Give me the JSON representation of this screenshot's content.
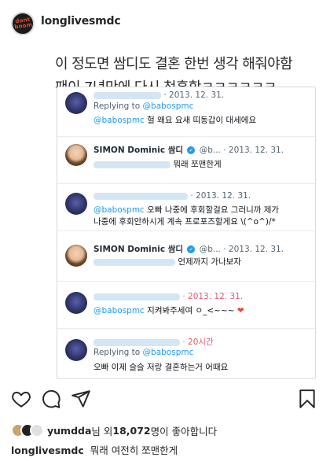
{
  "header": {
    "username": "longlivesmdc",
    "avatar_text": "dont\nboom"
  },
  "caption": {
    "line1": "이 정도면 쌈디도 결혼 한번 생각 해줘야함",
    "line2": "팬이 7년만에 다시 청혼함ㅋㅋㅋㅋㅋㅋ"
  },
  "tweets": [
    {
      "kind": "fan",
      "replying_label": "Replying to",
      "reply_to": "@babospmc",
      "date": "· 2013. 12. 31.",
      "mention": "@babospmc",
      "text": "헐 왜요 요새 띠동갑이 대세에요"
    },
    {
      "kind": "simon",
      "name": "SIMON Dominic 쌈디",
      "handle": "@b...",
      "date": "· 2013. 12. 31.",
      "text": "뭐래 쪼맨한게"
    },
    {
      "kind": "fan",
      "date": "· 2013. 12. 31.",
      "mention": "@babospmc",
      "text": "오빠 나중에 후회할걸요 그러니까 제가",
      "text2": "나중에 후회안하시게 계속 프로포즈할게요 \\(^o^)/*"
    },
    {
      "kind": "simon",
      "name": "SIMON Dominic 쌈디",
      "handle": "@b...",
      "date": "· 2013. 12. 31.",
      "text": "언제까지 가나보자"
    },
    {
      "kind": "fan",
      "date": "· 2013. 12. 31.",
      "mention": "@babospmc",
      "text": "지켜봐주세여 ㅇ_<~~~",
      "heart": "❤"
    },
    {
      "kind": "fan",
      "replying_label": "Replying to",
      "reply_to": "@babospmc",
      "date": "· 20시간",
      "text": "오빠 이제 슬슬 저랑 결혼하는거 어때요"
    }
  ],
  "likes": {
    "user": "yumdda",
    "text_mid": "님 외 ",
    "count": "18,072",
    "text_end": "명이 좋아합니다"
  },
  "comment": {
    "user": "longlivesmdc",
    "text": "뭐래 여전히 쪼맨한게"
  },
  "icons": {
    "like": "heart-outline-icon",
    "comment": "speech-bubble-icon",
    "share": "paper-plane-icon",
    "save": "bookmark-icon"
  }
}
